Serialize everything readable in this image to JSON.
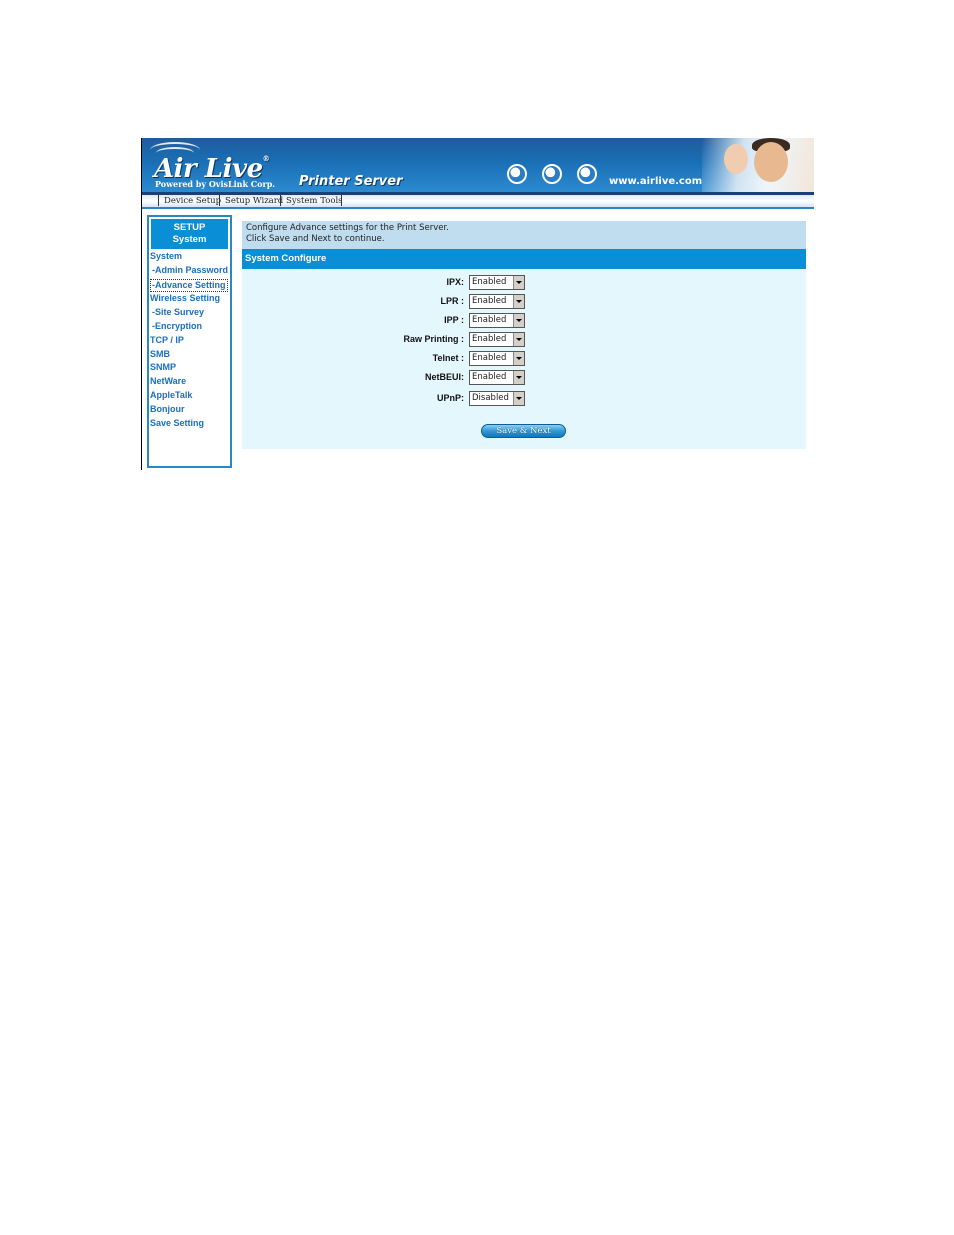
{
  "header": {
    "logo_text": "Air Live",
    "logo_mark": "®",
    "powered_by": "Powered by OvisLink Corp.",
    "product": "Printer Server",
    "website": "www.airlive.com",
    "globe_icons": [
      "globe-africa-icon",
      "globe-americas-icon",
      "globe-asia-icon"
    ]
  },
  "nav": {
    "items": [
      {
        "label": "Device Setup"
      },
      {
        "label": "Setup Wizard"
      },
      {
        "label": "System Tools"
      }
    ]
  },
  "sidebar": {
    "heading_line1": "SETUP",
    "heading_line2": "System",
    "items": [
      {
        "label": "System",
        "sub": false
      },
      {
        "label": "-Admin Password",
        "sub": true
      },
      {
        "label": "-Advance Setting",
        "sub": true,
        "active": true
      },
      {
        "label": "Wireless Setting",
        "sub": false
      },
      {
        "label": "-Site Survey",
        "sub": true
      },
      {
        "label": "-Encryption",
        "sub": true
      },
      {
        "label": "TCP / IP",
        "sub": false
      },
      {
        "label": "SMB",
        "sub": false
      },
      {
        "label": "SNMP",
        "sub": false
      },
      {
        "label": "NetWare",
        "sub": false
      },
      {
        "label": "AppleTalk",
        "sub": false
      },
      {
        "label": "Bonjour",
        "sub": false
      },
      {
        "label": "Save Setting",
        "sub": false
      }
    ]
  },
  "content": {
    "info_line1": "Configure Advance settings for the Print Server.",
    "info_line2": "Click Save and Next to continue.",
    "section_title": "System Configure",
    "fields": [
      {
        "label": "IPX:",
        "value": "Enabled"
      },
      {
        "label": "LPR :",
        "value": "Enabled"
      },
      {
        "label": "IPP :",
        "value": "Enabled"
      },
      {
        "label": "Raw Printing :",
        "value": "Enabled"
      },
      {
        "label": "Telnet :",
        "value": "Enabled"
      },
      {
        "label": "NetBEUI:",
        "value": "Enabled"
      },
      {
        "label": "UPnP:",
        "value": "Disabled"
      }
    ],
    "save_button": "Save & Next"
  },
  "colors": {
    "accent": "#0a8fd6",
    "info_bg": "#c0ddef",
    "form_bg": "#e4f7fc",
    "link": "#1a6fbf"
  }
}
